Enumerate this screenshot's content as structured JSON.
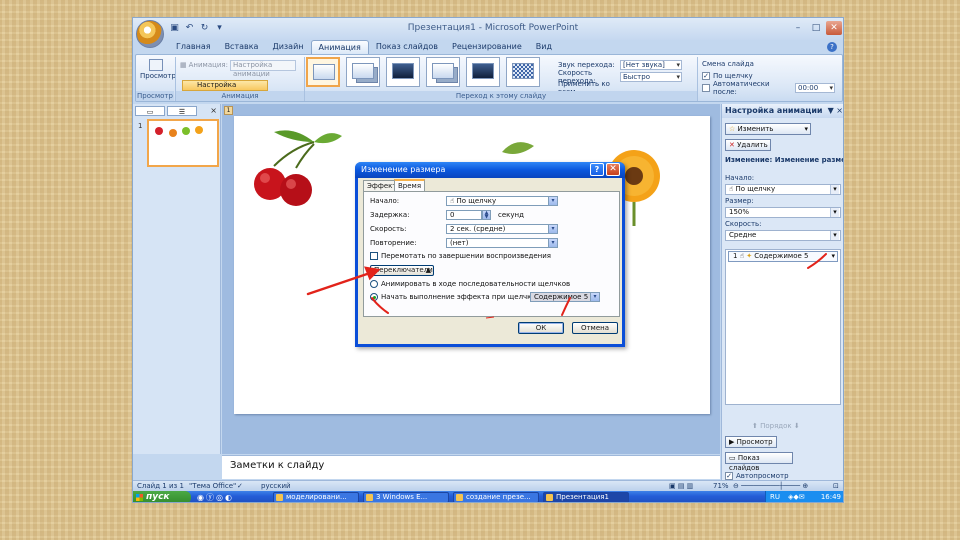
{
  "titlebar": {
    "title": "Презентация1 - Microsoft PowerPoint",
    "qat_icons": [
      "save-icon",
      "undo-icon",
      "redo-icon",
      "customize-icon"
    ]
  },
  "tabs": [
    {
      "label": "Главная",
      "active": false
    },
    {
      "label": "Вставка",
      "active": false
    },
    {
      "label": "Дизайн",
      "active": false
    },
    {
      "label": "Анимация",
      "active": true
    },
    {
      "label": "Показ слайдов",
      "active": false
    },
    {
      "label": "Рецензирование",
      "active": false
    },
    {
      "label": "Вид",
      "active": false
    }
  ],
  "ribbon": {
    "preview_group": {
      "button": "Просмотр",
      "label": "Просмотр"
    },
    "animation_group": {
      "animate_label": "Анимация:",
      "animate_value": "Настройка анимации",
      "custom_button": "Настройка анимации",
      "label": "Анимация"
    },
    "transition_group": {
      "sound_label": "Звук перехода:",
      "sound_value": "[Нет звука]",
      "speed_label": "Скорость перехода:",
      "speed_value": "Быстро",
      "apply_all": "Применить ко всем",
      "label": "Переход к этому слайду"
    },
    "advance_group": {
      "title": "Смена слайда",
      "on_click": "По щелчку",
      "on_click_checked": true,
      "auto_label": "Автоматически после:",
      "auto_value": "00:00",
      "auto_checked": false
    }
  },
  "left_pane": {
    "slide_number": "1"
  },
  "slide": {
    "tag": "1"
  },
  "notes": {
    "label": "Заметки к слайду"
  },
  "task_pane": {
    "title": "Настройка анимации",
    "change_button": "Изменить",
    "remove_button": "Удалить",
    "effect_title": "Изменение: Изменение размер",
    "start_label": "Начало:",
    "start_value": "По щелчку",
    "size_label": "Размер:",
    "size_value": "150%",
    "speed_label": "Скорость:",
    "speed_value": "Средне",
    "list_item_number": "1",
    "list_item_text": "Содержимое 5",
    "order_label": "Порядок",
    "preview_button": "Просмотр",
    "slideshow_button": "Показ слайдов",
    "autopreview_label": "Автопросмотр",
    "autopreview_checked": true
  },
  "statusbar": {
    "slide_info": "Слайд 1 из 1",
    "theme": "\"Тема Office\"",
    "language": "русский",
    "zoom": "71%"
  },
  "taskbar": {
    "start": "пуск",
    "items": [
      {
        "label": "моделировани...",
        "active": false
      },
      {
        "label": "3 Windows E...",
        "active": false
      },
      {
        "label": "создание презе...",
        "active": false
      },
      {
        "label": "Презентация1",
        "active": true
      }
    ],
    "lang": "RU",
    "time": "16:49"
  },
  "dialog": {
    "title": "Изменение размера",
    "tabs": [
      {
        "label": "Эффект",
        "active": false
      },
      {
        "label": "Время",
        "active": true
      }
    ],
    "start_label": "Начало:",
    "start_value": "По щелчку",
    "delay_label": "Задержка:",
    "delay_value": "0",
    "delay_unit": "секунд",
    "speed_label": "Скорость:",
    "speed_value": "2 сек. (средне)",
    "repeat_label": "Повторение:",
    "repeat_value": "(нет)",
    "rewind_label": "Перемотать по завершении воспроизведения",
    "rewind_checked": false,
    "triggers_button": "Переключатели",
    "animate_sequence_label": "Анимировать в ходе последовательности щелчков",
    "start_on_click_label": "Начать выполнение эффекта при щелчке",
    "start_on_click_selected": true,
    "trigger_object": "Содержимое 5",
    "ok_button": "ОК",
    "cancel_button": "Отмена"
  },
  "colors": {
    "accent": "#0b57dd",
    "arrow_red": "#e2231a",
    "ribbon_blue": "#c3d7ef"
  }
}
